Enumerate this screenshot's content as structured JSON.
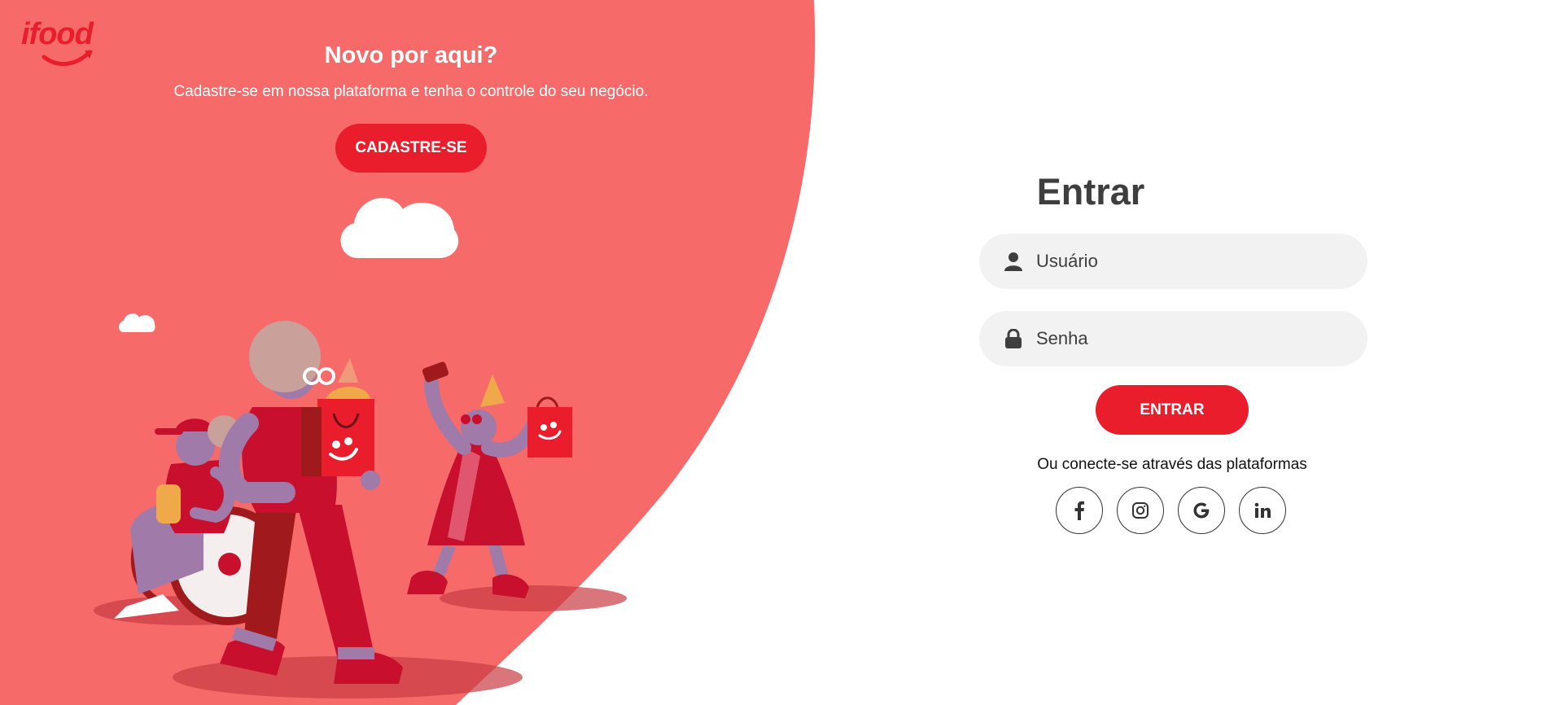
{
  "brand": {
    "logo_text": "ifood",
    "primary_color": "#ea1d2c",
    "panel_color": "#f66a6a"
  },
  "hero": {
    "title": "Novo por aqui?",
    "subtitle": "Cadastre-se em nossa plataforma e tenha o controle do seu negócio.",
    "signup_label": "CADASTRE-SE"
  },
  "login": {
    "title": "Entrar",
    "username_placeholder": "Usuário",
    "password_placeholder": "Senha",
    "submit_label": "ENTRAR",
    "social_text": "Ou conecte-se através das plataformas",
    "social": [
      {
        "name": "facebook",
        "icon": "facebook-icon"
      },
      {
        "name": "instagram",
        "icon": "instagram-icon"
      },
      {
        "name": "google",
        "icon": "google-icon"
      },
      {
        "name": "linkedin",
        "icon": "linkedin-icon"
      }
    ]
  }
}
